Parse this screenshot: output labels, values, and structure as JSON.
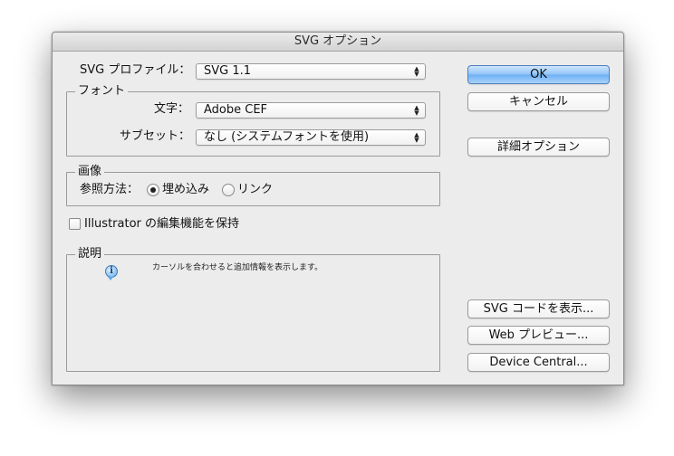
{
  "window": {
    "title": "SVG オプション"
  },
  "profile": {
    "label": "SVG プロファイル：",
    "value": "SVG 1.1"
  },
  "font_group": {
    "legend": "フォント",
    "char_label": "文字：",
    "char_value": "Adobe CEF",
    "subset_label": "サブセット：",
    "subset_value": "なし (システムフォントを使用)"
  },
  "image_group": {
    "legend": "画像",
    "method_label": "参照方法：",
    "embed_label": "埋め込み",
    "link_label": "リンク",
    "selected": "embed"
  },
  "preserve_checkbox": {
    "label": "Illustrator の編集機能を保持",
    "checked": false
  },
  "description_group": {
    "legend": "説明",
    "text": "カーソルを合わせると追加情報を表示します。",
    "icon": "info-icon"
  },
  "buttons": {
    "ok": "OK",
    "cancel": "キャンセル",
    "advanced": "詳細オプション",
    "show_code": "SVG コードを表示...",
    "web_preview": "Web プレビュー...",
    "device_central": "Device Central..."
  },
  "colors": {
    "default_button": "#8ec3f7",
    "window_bg": "#ececec"
  }
}
